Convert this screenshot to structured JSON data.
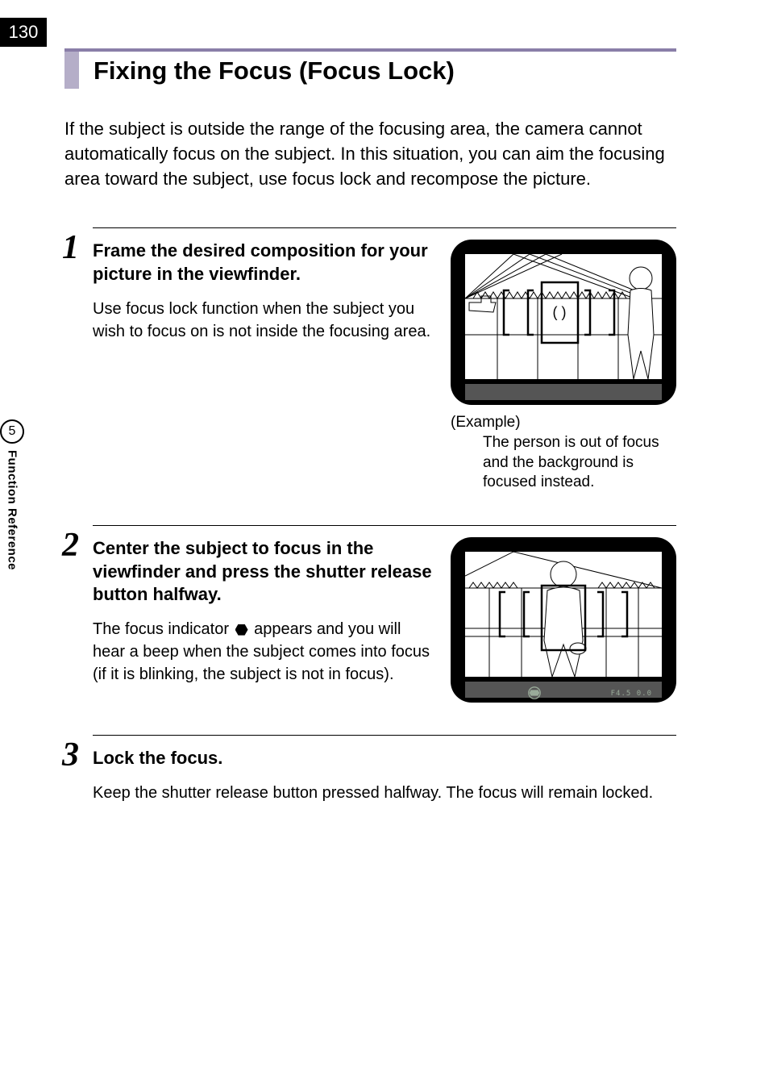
{
  "page_number": "130",
  "side_tab": {
    "number": "5",
    "label": "Function Reference"
  },
  "section_title": "Fixing the Focus (Focus Lock)",
  "intro": "If the subject is outside the range of the focusing area, the camera cannot automatically focus on the subject. In this situation, you can aim the focusing area toward the subject, use focus lock and recompose the picture.",
  "steps": [
    {
      "num": "1",
      "title": "Frame the desired composition for your picture in the viewfinder.",
      "body": "Use focus lock function when the subject you wish to focus on is not inside the focusing area.",
      "caption_head": "(Example)",
      "caption_body": "The person is out of focus and the background is focused instead."
    },
    {
      "num": "2",
      "title": "Center the subject to focus in the viewfinder and press the shutter release button halfway.",
      "body_pre": "The focus indicator ",
      "body_post": " appears and you will hear a beep when the subject comes into focus (if it is blinking, the subject is not in focus).",
      "vf_display": "F4.5   0.0"
    },
    {
      "num": "3",
      "title": "Lock the focus.",
      "body": "Keep the shutter release button pressed halfway. The focus will remain locked."
    }
  ]
}
